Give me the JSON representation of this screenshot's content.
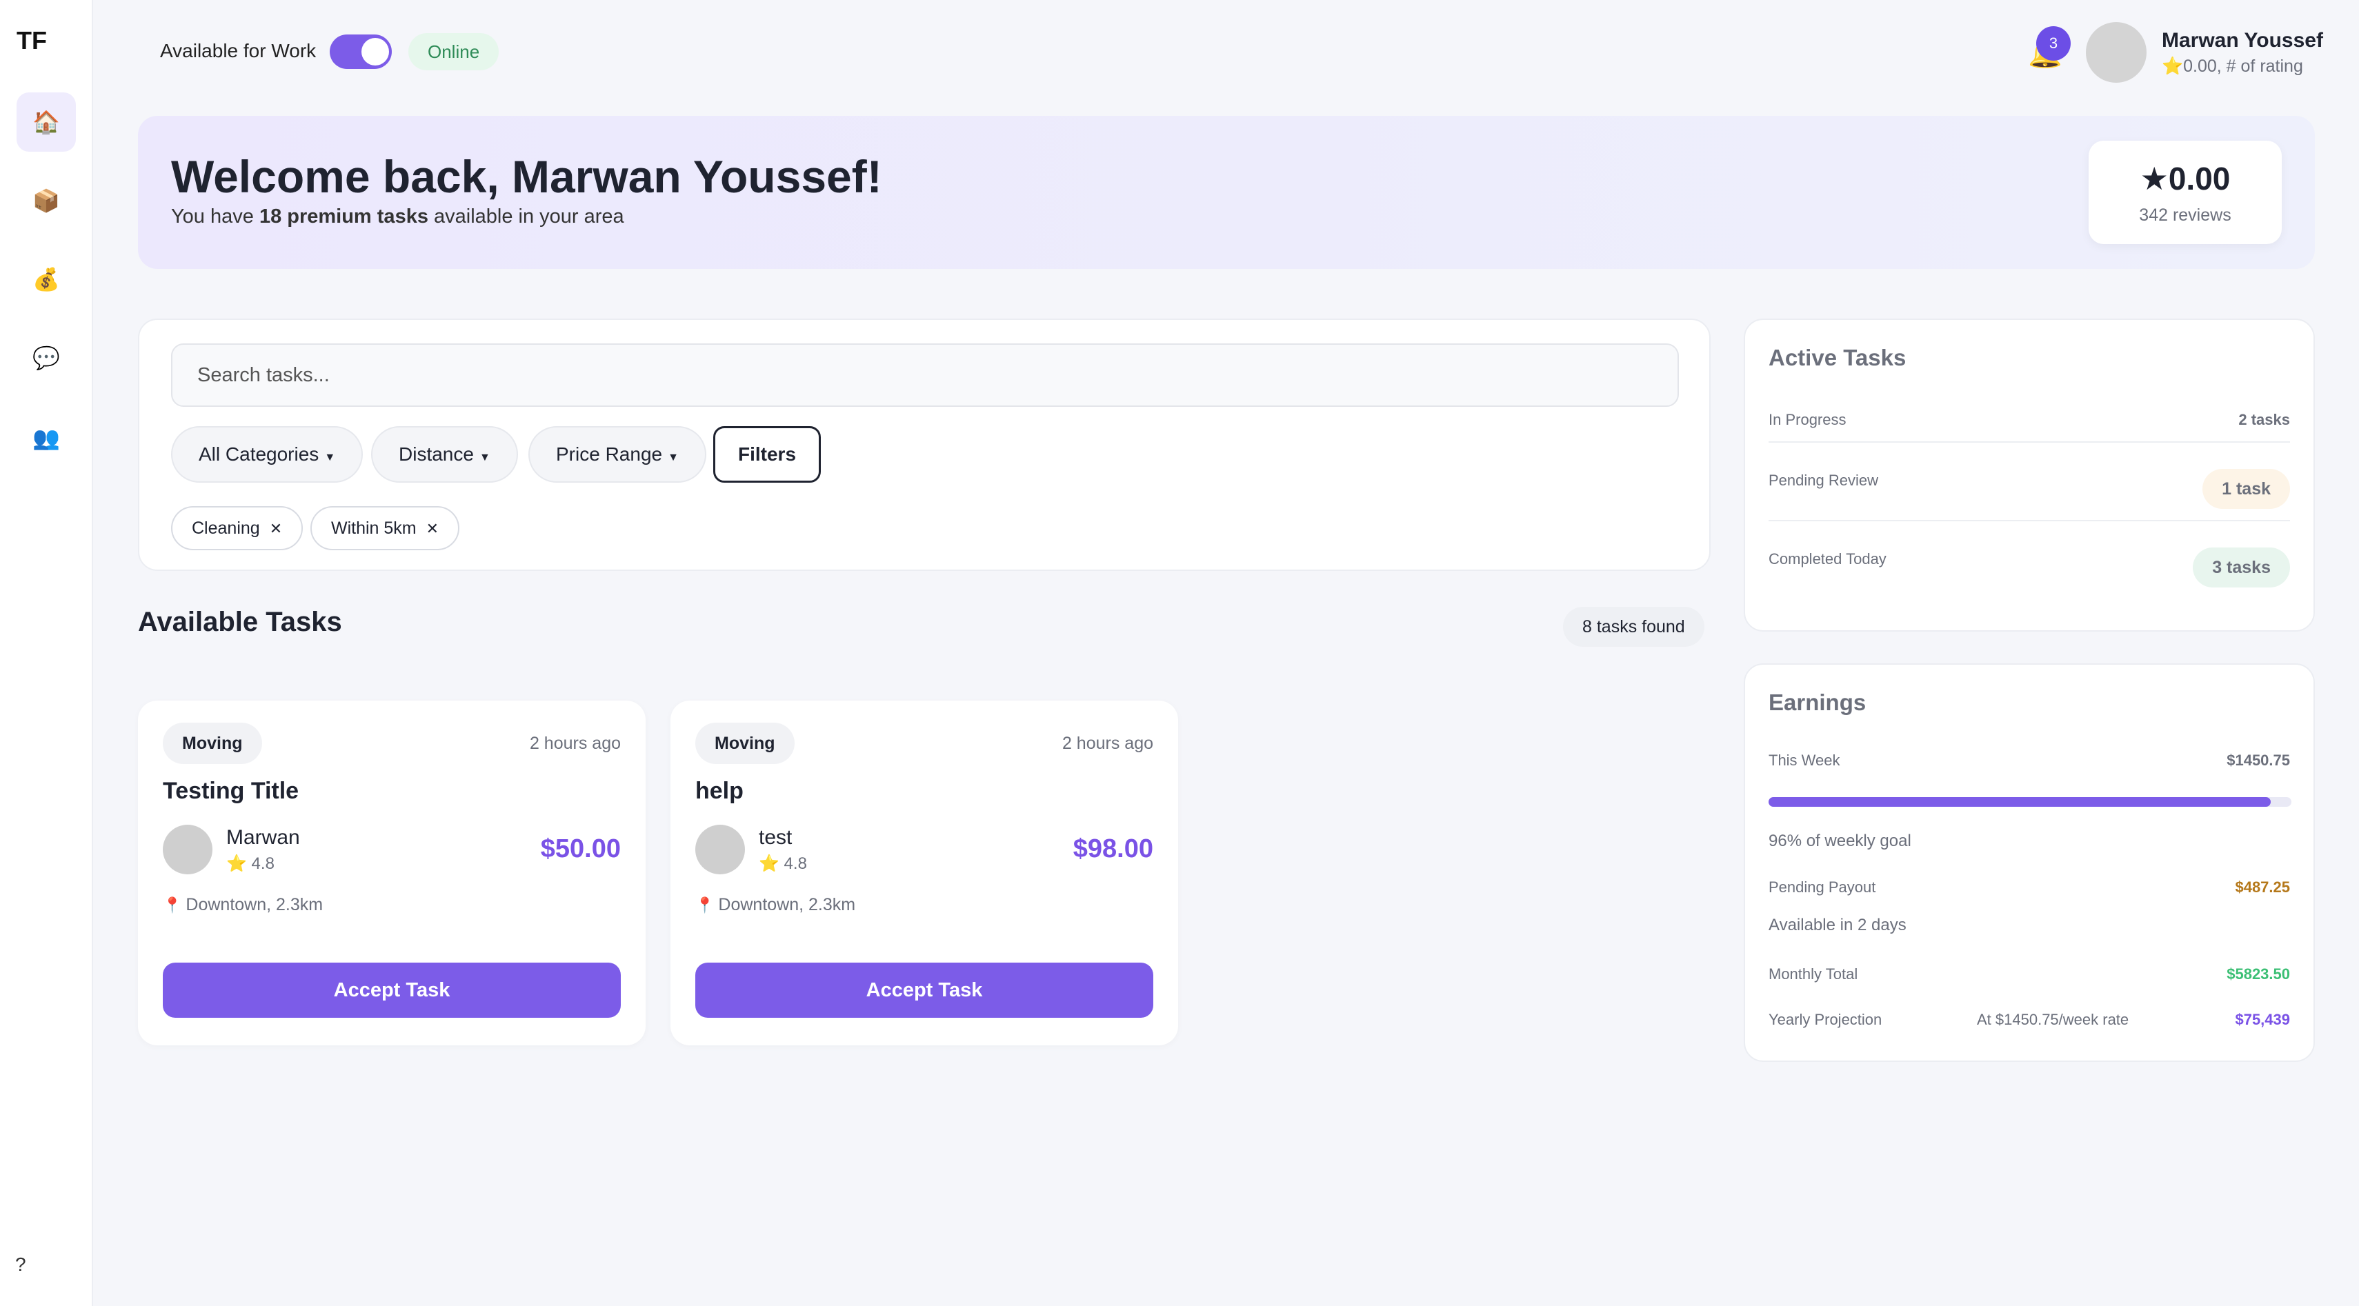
{
  "sidebar": {
    "logo": "TF",
    "items": [
      {
        "icon": "home-icon",
        "glyph": "🏠",
        "active": true
      },
      {
        "icon": "box-icon",
        "glyph": "📦",
        "active": false
      },
      {
        "icon": "money-bag-icon",
        "glyph": "💰",
        "active": false
      },
      {
        "icon": "chat-icon",
        "glyph": "💬",
        "active": false
      },
      {
        "icon": "users-icon",
        "glyph": "👥",
        "active": false
      }
    ],
    "help": "?"
  },
  "topbar": {
    "availability_label": "Available for Work",
    "availability_on": true,
    "status": "Online",
    "notification_count": "3",
    "user_name": "Marwan Youssef",
    "user_rating": "⭐0.00, # of rating"
  },
  "banner": {
    "title": "Welcome back, Marwan Youssef!",
    "subtitle_prefix": "You have ",
    "subtitle_bold": "18 premium tasks",
    "subtitle_suffix": " available in your area",
    "rating": "★0.00",
    "reviews": "342 reviews"
  },
  "search": {
    "placeholder": "Search tasks...",
    "dropdowns": [
      "All Categories",
      "Distance",
      "Price Range"
    ],
    "filters_label": "Filters",
    "chips": [
      "Cleaning",
      "Within 5km"
    ]
  },
  "tasks_section": {
    "title": "Available Tasks",
    "found": "8 tasks found"
  },
  "tasks": [
    {
      "category": "Moving",
      "time": "2 hours ago",
      "title": "Testing Title",
      "user": "Marwan",
      "user_rating": "⭐ 4.8",
      "price": "$50.00",
      "location": "Downtown, 2.3km",
      "button": "Accept Task"
    },
    {
      "category": "Moving",
      "time": "2 hours ago",
      "title": "help",
      "user": "test",
      "user_rating": "⭐ 4.8",
      "price": "$98.00",
      "location": "Downtown, 2.3km",
      "button": "Accept Task"
    }
  ],
  "active_tasks": {
    "title": "Active Tasks",
    "in_progress_label": "In Progress",
    "in_progress_value": "2 tasks",
    "pending_label": "Pending Review",
    "pending_value": "1 task",
    "completed_label": "Completed Today",
    "completed_value": "3 tasks"
  },
  "earnings": {
    "title": "Earnings",
    "week_label": "This Week",
    "week_value": "$1450.75",
    "goal_percent": 96,
    "goal_text": "96% of weekly goal",
    "payout_label": "Pending Payout",
    "payout_value": "$487.25",
    "payout_note": "Available in 2 days",
    "monthly_label": "Monthly Total",
    "monthly_value": "$5823.50",
    "yearly_label": "Yearly Projection",
    "yearly_note": "At $1450.75/week rate",
    "yearly_value": "$75,439"
  },
  "colors": {
    "accent": "#7c5ce8",
    "payout": "#b5781a",
    "monthly": "#3bbf74",
    "yearly": "#7a52e6"
  }
}
